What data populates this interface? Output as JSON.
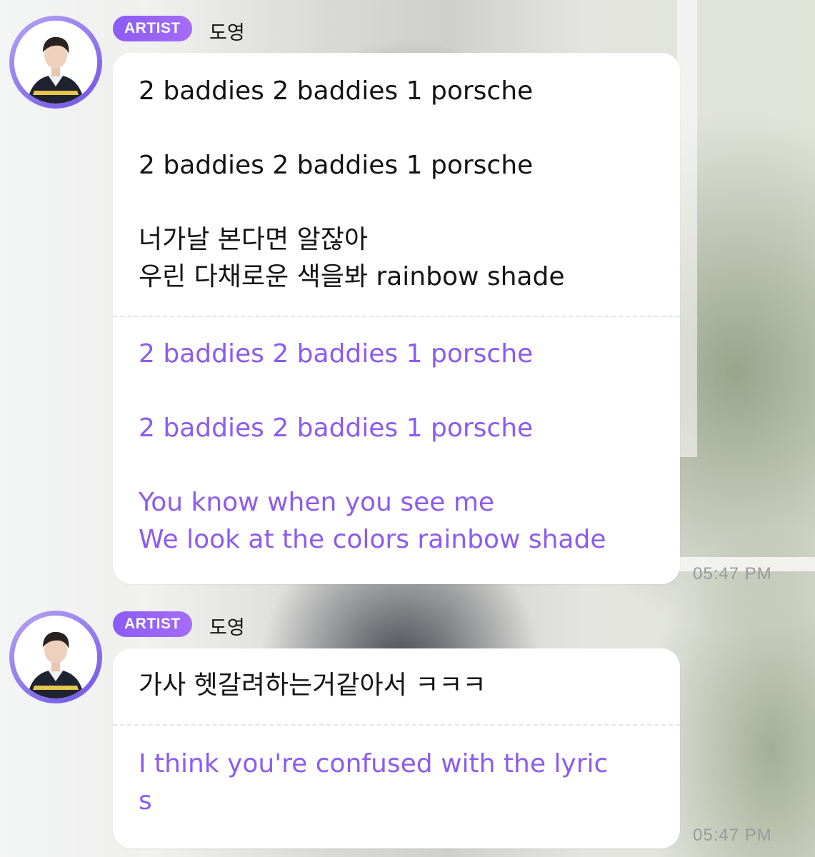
{
  "messages": [
    {
      "badge": "ARTIST",
      "author": "도영",
      "original": "2 baddies 2 baddies 1 porsche\n\n2 baddies 2 baddies 1 porsche\n\n너가날 본다면 알잖아\n우린 다채로운 색을봐 rainbow shade",
      "translation": "2 baddies 2 baddies 1 porsche\n\n2 baddies 2 baddies 1 porsche\n\nYou know when you see me\nWe look at the colors rainbow shade",
      "time": "05:47 PM"
    },
    {
      "badge": "ARTIST",
      "author": "도영",
      "original": "가사 헷갈려하는거같아서 ㅋㅋㅋ",
      "translation": "I think you're confused with the lyric\ns",
      "time": "05:47 PM"
    }
  ],
  "colors": {
    "badge": "#8b5cf6",
    "translation_text": "#8c5bf0",
    "avatar_ring": "#8f78ee"
  }
}
